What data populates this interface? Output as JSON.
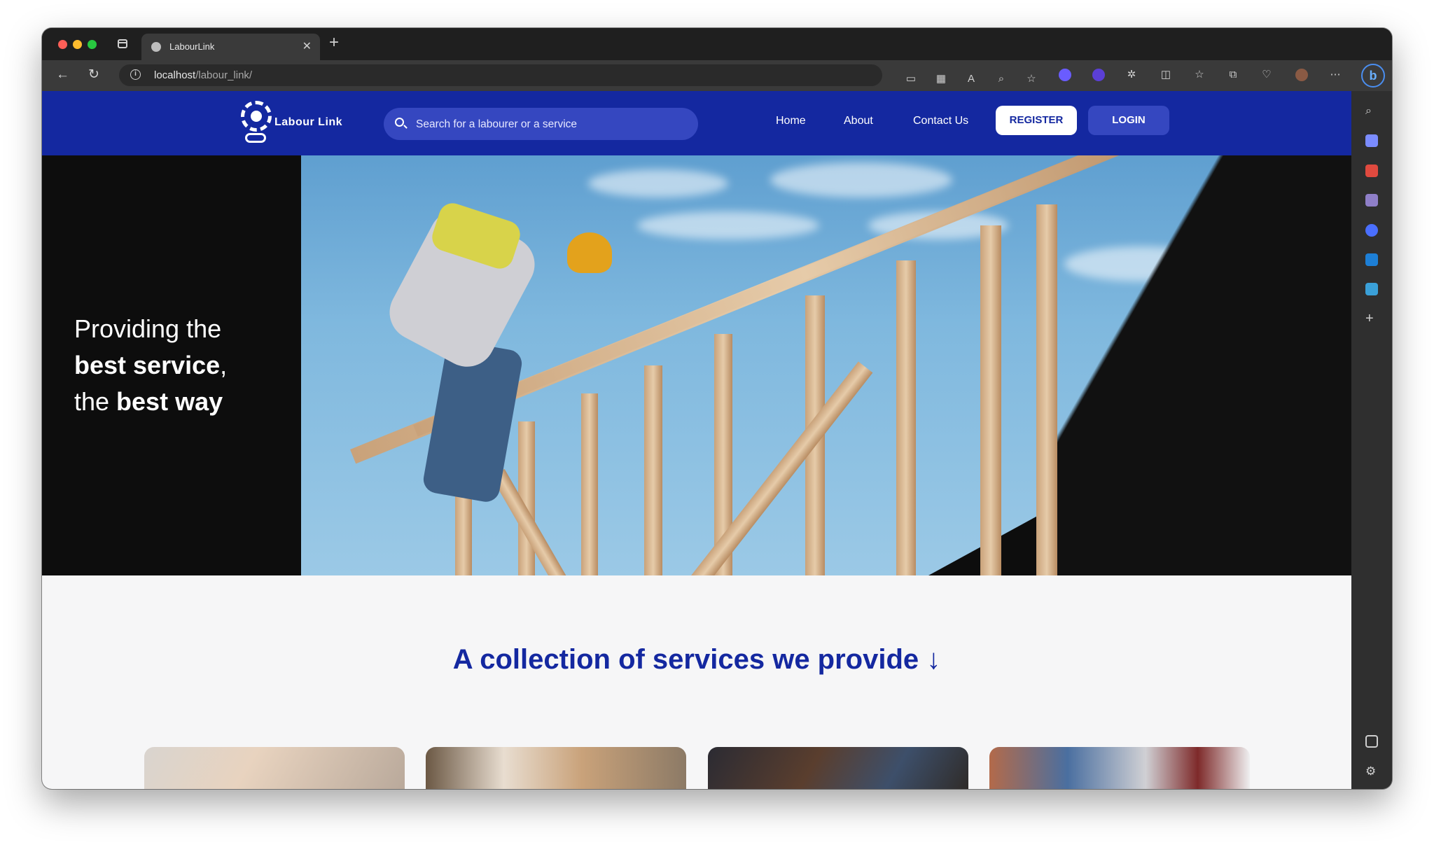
{
  "browser": {
    "tab_title": "LabourLink",
    "url_host": "localhost",
    "url_path": "/labour_link/"
  },
  "site": {
    "logo_text": "Labour Link",
    "search_placeholder": "Search for a labourer or a service",
    "nav": [
      "Home",
      "About",
      "Contact Us"
    ],
    "register_label": "REGISTER",
    "login_label": "LOGIN",
    "brand_color": "#1428a0"
  },
  "hero": {
    "line1": "Providing the",
    "line2_bold": "best service",
    "line2_suffix": ",",
    "line3_prefix": "the ",
    "line3_bold": "best way"
  },
  "services": {
    "title": "A collection of services we provide ↓",
    "cards": [
      "plumbing-image",
      "carpentry-image",
      "electrical-image",
      "painting-image"
    ]
  }
}
